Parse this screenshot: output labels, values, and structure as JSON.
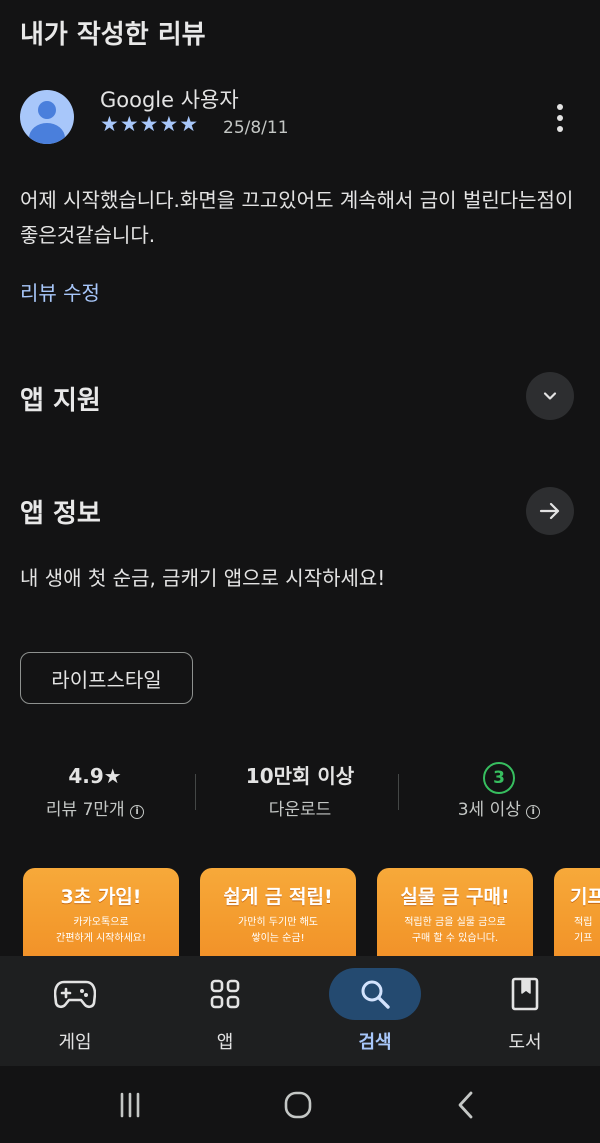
{
  "my_review": {
    "section_title": "내가 작성한 리뷰",
    "reviewer_name": "Google 사용자",
    "stars": "★★★★★",
    "date": "25/8/11",
    "text": "어제 시작했습니다.화면을 끄고있어도 계속해서 금이 벌린다는점이 좋은것같습니다.",
    "edit_label": "리뷰 수정"
  },
  "app_support": {
    "title": "앱 지원"
  },
  "app_info": {
    "title": "앱 정보",
    "tagline": "내 생애 첫 순금, 금캐기 앱으로 시작하세요!",
    "category_chip": "라이프스타일"
  },
  "stats": {
    "rating": {
      "value": "4.9",
      "star": "★",
      "label": "리뷰 7만개"
    },
    "downloads": {
      "value": "10만회 이상",
      "label": "다운로드"
    },
    "age": {
      "badge": "3",
      "label": "3세 이상"
    },
    "info_glyph": "i"
  },
  "screenshots": [
    {
      "title": "3초 가입!",
      "line1": "카카오톡으로",
      "line2": "간편하게 시작하세요!"
    },
    {
      "title": "쉽게 금 적립!",
      "line1": "가만히 두기만 해도",
      "line2": "쌓이는 순금!"
    },
    {
      "title": "실물 금 구매!",
      "line1": "적립한 금을 실물 금으로",
      "line2": "구매 할 수 있습니다."
    },
    {
      "title": "기프",
      "line1": "적립",
      "line2": "기프"
    }
  ],
  "bottom_nav": {
    "games": "게임",
    "apps": "앱",
    "search": "검색",
    "books": "도서"
  },
  "colors": {
    "background": "#131314",
    "accent_blue": "#a8c7fa",
    "active_pill": "#244a70",
    "age_green": "#37be5f",
    "screenshot_orange": "#f39a2d"
  }
}
